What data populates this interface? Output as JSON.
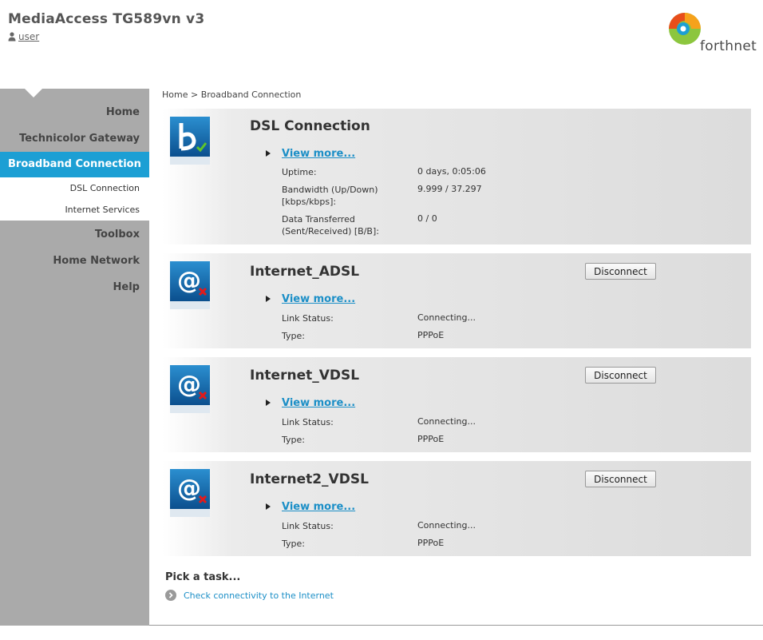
{
  "header": {
    "title": "MediaAccess TG589vn v3",
    "user_label": "user",
    "brand": "forthnet"
  },
  "sidebar": {
    "items": [
      {
        "label": "Home"
      },
      {
        "label": "Technicolor Gateway"
      },
      {
        "label": "Broadband Connection",
        "active": true
      },
      {
        "label": "Toolbox"
      },
      {
        "label": "Home Network"
      },
      {
        "label": "Help"
      }
    ],
    "subitems": [
      {
        "label": "DSL Connection"
      },
      {
        "label": "Internet Services"
      }
    ]
  },
  "breadcrumb": "Home > Broadband Connection",
  "dsl": {
    "title": "DSL Connection",
    "view_more": "View more...",
    "rows": [
      {
        "label": "Uptime:",
        "value": "0 days, 0:05:06"
      },
      {
        "label": "Bandwidth (Up/Down) [kbps/kbps]:",
        "value": "9.999 / 37.297"
      },
      {
        "label": "Data Transferred (Sent/Received) [B/B]:",
        "value": "0 / 0"
      }
    ]
  },
  "connections": [
    {
      "title": "Internet_ADSL",
      "button": "Disconnect",
      "view_more": "View more...",
      "link_status_label": "Link Status:",
      "link_status": "Connecting...",
      "type_label": "Type:",
      "type": "PPPoE"
    },
    {
      "title": "Internet_VDSL",
      "button": "Disconnect",
      "view_more": "View more...",
      "link_status_label": "Link Status:",
      "link_status": "Connecting...",
      "type_label": "Type:",
      "type": "PPPoE"
    },
    {
      "title": "Internet2_VDSL",
      "button": "Disconnect",
      "view_more": "View more...",
      "link_status_label": "Link Status:",
      "link_status": "Connecting...",
      "type_label": "Type:",
      "type": "PPPoE"
    }
  ],
  "tasks": {
    "title": "Pick a task...",
    "items": [
      {
        "label": "Check connectivity to the Internet"
      }
    ]
  },
  "colors": {
    "accent": "#1c9fd4",
    "link": "#1c8fc7",
    "sidebar": "#aaaaaa"
  }
}
